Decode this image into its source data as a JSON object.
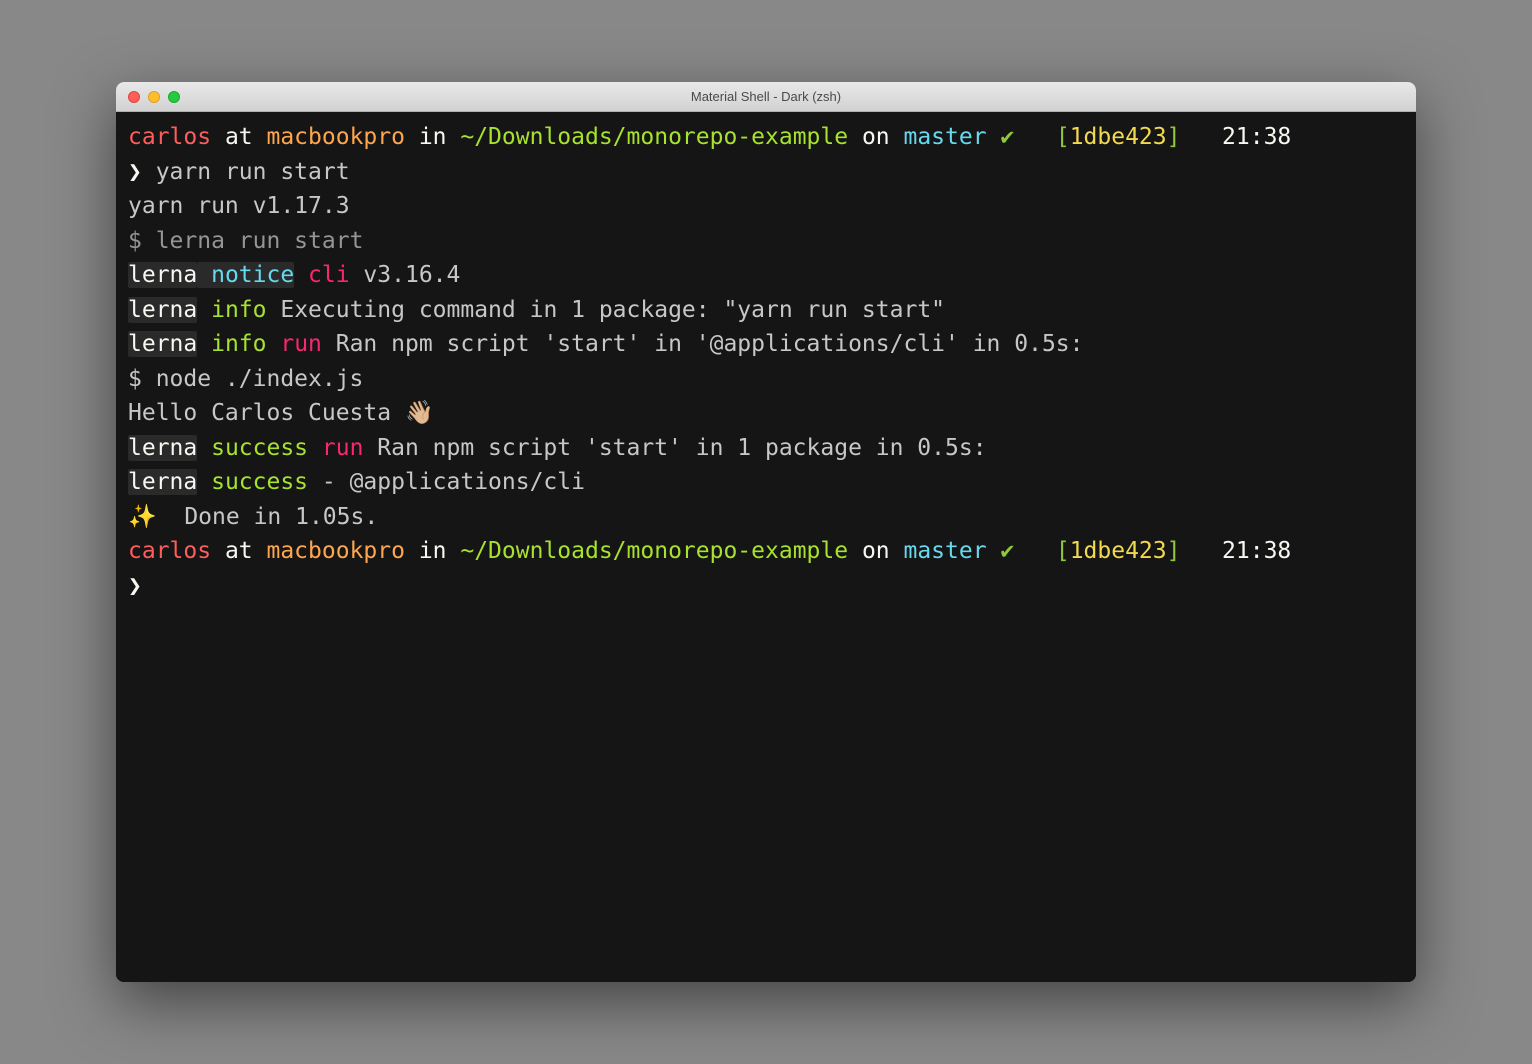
{
  "window": {
    "title": "Material Shell - Dark (zsh)"
  },
  "prompt1": {
    "user": "carlos",
    "at": " at ",
    "host": "macbookpro",
    "in": " in ",
    "path": "~/Downloads/monorepo-example",
    "on": " on ",
    "branch": "master",
    "check": " ✔",
    "spaces1": "   ",
    "bracket_open": "[",
    "commit": "1dbe423",
    "bracket_close": "]",
    "spaces2": "   ",
    "time": "21:38"
  },
  "input1": {
    "caret": "❯ ",
    "command": "yarn run start"
  },
  "out1": "yarn run v1.17.3",
  "out2": {
    "dollar": "$ ",
    "cmd": "lerna run start"
  },
  "out3": {
    "lerna": "lerna",
    "notice": " notice",
    "cli": " cli",
    "version": " v3.16.4"
  },
  "out4": {
    "lerna": "lerna",
    "info": " info",
    "msg": " Executing command in 1 package: \"yarn run start\""
  },
  "out5": {
    "lerna": "lerna",
    "info": " info",
    "run": " run",
    "msg": " Ran npm script 'start' in '@applications/cli' in 0.5s:"
  },
  "out6": "$ node ./index.js",
  "out7": "Hello Carlos Cuesta 👋🏼",
  "out8": {
    "lerna": "lerna",
    "success": " success",
    "run": " run",
    "msg": " Ran npm script 'start' in 1 package in 0.5s:"
  },
  "out9": {
    "lerna": "lerna",
    "success": " success",
    "msg": " - @applications/cli"
  },
  "out10": "✨  Done in 1.05s.",
  "prompt2": {
    "user": "carlos",
    "at": " at ",
    "host": "macbookpro",
    "in": " in ",
    "path": "~/Downloads/monorepo-example",
    "on": " on ",
    "branch": "master",
    "check": " ✔",
    "spaces1": "   ",
    "bracket_open": "[",
    "commit": "1dbe423",
    "bracket_close": "]",
    "spaces2": "   ",
    "time": "21:38"
  },
  "input2": {
    "caret": "❯"
  }
}
